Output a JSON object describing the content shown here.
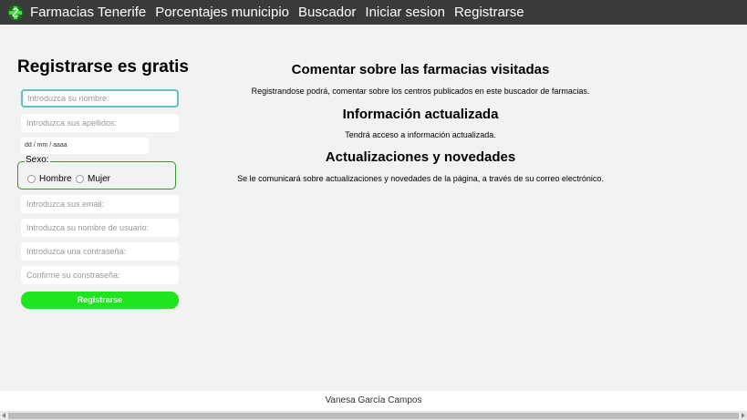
{
  "nav": {
    "logo_icon": "green-cross-icon",
    "brand": "Farmacias Tenerife",
    "links": [
      "Porcentajes municipio",
      "Buscador",
      "Iniciar sesion",
      "Registrarse"
    ]
  },
  "form": {
    "title": "Registrarse es gratis",
    "placeholders": {
      "nombre": "Introduzca su nombre:",
      "apellidos": "Introduzca sus apellidos:",
      "email": "Introduzca sus email:",
      "usuario": "Introduzca su nombre de usuario:",
      "contrasena": "Introduzca una contraseña:",
      "confirmar": "Confirme su constraseña:"
    },
    "date_placeholder": "dd / mm / aaaa",
    "sexo_label": "Sexo:",
    "sexo_options": [
      "Hombre",
      "Mujer"
    ],
    "submit_label": "Registrarse"
  },
  "info": {
    "sections": [
      {
        "heading": "Comentar sobre las farmacias visitadas",
        "text": "Registrandose podrá, comentar sobre los centros publicados en este buscador de farmacias."
      },
      {
        "heading": "Información actualizada",
        "text": "Tendrá acceso a información actualizada."
      },
      {
        "heading": "Actualizaciones y novedades",
        "text": "Se le comunicará sobre actualizaciones y novedades de la página, a través de su correo electrónico."
      }
    ]
  },
  "footer": {
    "author": "Vanesa García Campos"
  },
  "colors": {
    "navbar": "#3a3a3a",
    "accent_green": "#1ee51e",
    "fieldset_border": "#2e9b2e"
  }
}
